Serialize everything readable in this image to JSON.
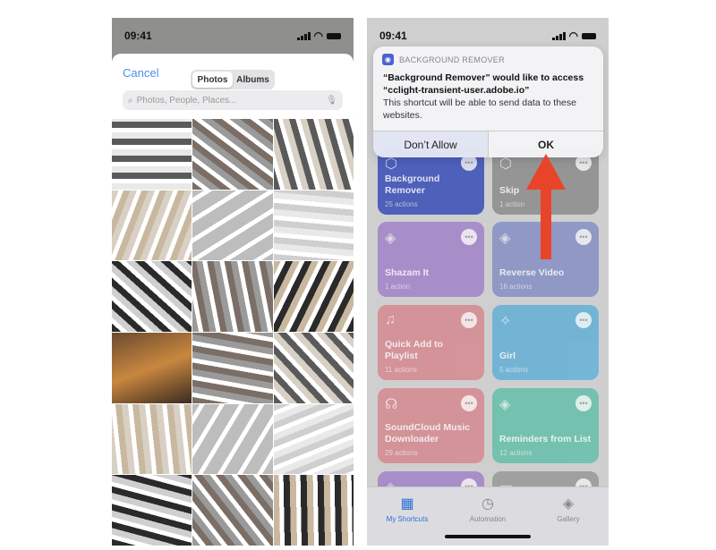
{
  "left": {
    "status": {
      "time": "09:41"
    },
    "cancel": "Cancel",
    "segments": [
      {
        "label": "Photos",
        "selected": true
      },
      {
        "label": "Albums",
        "selected": false
      }
    ],
    "search_placeholder": "Photos, People, Places...",
    "photo_count": 18
  },
  "right": {
    "status": {
      "time": "09:41"
    },
    "alert": {
      "app": "BACKGROUND REMOVER",
      "title": "“Background Remover” would like to access “cclight-transient-user.adobe.io”",
      "message": "This shortcut will be able to send data to these websites.",
      "deny": "Don’t Allow",
      "ok": "OK"
    },
    "shortcuts": [
      {
        "name": "Background Remover",
        "actions": "25 actions",
        "color": "#3f55b8",
        "icon": "shortcut-icon"
      },
      {
        "name": "Skip",
        "actions": "1 action",
        "color": "#8f8f8f",
        "icon": "shortcut-icon"
      },
      {
        "name": "Shazam It",
        "actions": "1 action",
        "color": "#a387c9",
        "icon": "layers-icon"
      },
      {
        "name": "Reverse Video",
        "actions": "16 actions",
        "color": "#8a93c4",
        "icon": "layers-icon"
      },
      {
        "name": "Quick Add to Playlist",
        "actions": "11 actions",
        "color": "#d48d94",
        "icon": "music-icon"
      },
      {
        "name": "Girl",
        "actions": "5 actions",
        "color": "#6ab2d6",
        "icon": "magic-wand-icon"
      },
      {
        "name": "SoundCloud Music Downloader",
        "actions": "29 actions",
        "color": "#d48d94",
        "icon": "headphones-icon"
      },
      {
        "name": "Reminders from List",
        "actions": "12 actions",
        "color": "#6cc0ad",
        "icon": "layers-icon"
      },
      {
        "name": "",
        "actions": "",
        "color": "#a387c9",
        "icon": "layers-icon"
      },
      {
        "name": "",
        "actions": "",
        "color": "#9c9c9c",
        "icon": "notes-icon"
      }
    ],
    "tabs": [
      {
        "label": "My Shortcuts",
        "active": true,
        "icon": "grid-icon"
      },
      {
        "label": "Automation",
        "active": false,
        "icon": "clock-icon"
      },
      {
        "label": "Gallery",
        "active": false,
        "icon": "layers-icon"
      }
    ],
    "annotation_color": "#e8442a"
  }
}
